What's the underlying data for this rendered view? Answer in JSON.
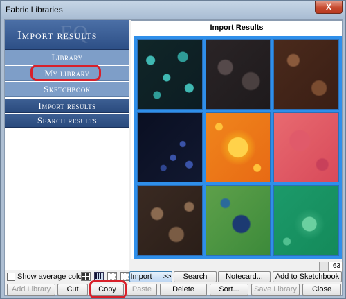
{
  "window": {
    "title": "Fabric Libraries",
    "close_label": "X"
  },
  "left": {
    "brand": "Import results",
    "watermark": "EQ",
    "nav": [
      {
        "label": "Library"
      },
      {
        "label": "My library"
      },
      {
        "label": "Sketchbook"
      },
      {
        "label": "Import results"
      },
      {
        "label": "Search results"
      }
    ]
  },
  "right": {
    "title": "Import Results",
    "swatches": [
      "teal dotted batik",
      "charcoal batik",
      "brown mottled batik",
      "navy dotted batik",
      "orange sun batik",
      "pink floral batik",
      "brown dotted batik",
      "green and navy batik",
      "green circle batik"
    ],
    "count": "63"
  },
  "controls": {
    "show_average_color": "Show average color",
    "import": "Import",
    "import_arrows": ">>",
    "search": "Search",
    "search_arrows": ">>",
    "notecard": "Notecard...",
    "add_to_sketchbook": "Add to Sketchbook",
    "add_library": "Add Library",
    "cut": "Cut",
    "copy": "Copy",
    "paste": "Paste",
    "delete": "Delete",
    "sort": "Sort...",
    "save_library": "Save Library",
    "close": "Close"
  },
  "colors": {
    "accent": "#2f8fea",
    "highlight": "#d8202a",
    "nav_dark": "#2a4a7d",
    "nav_light": "#7e9ec8"
  }
}
